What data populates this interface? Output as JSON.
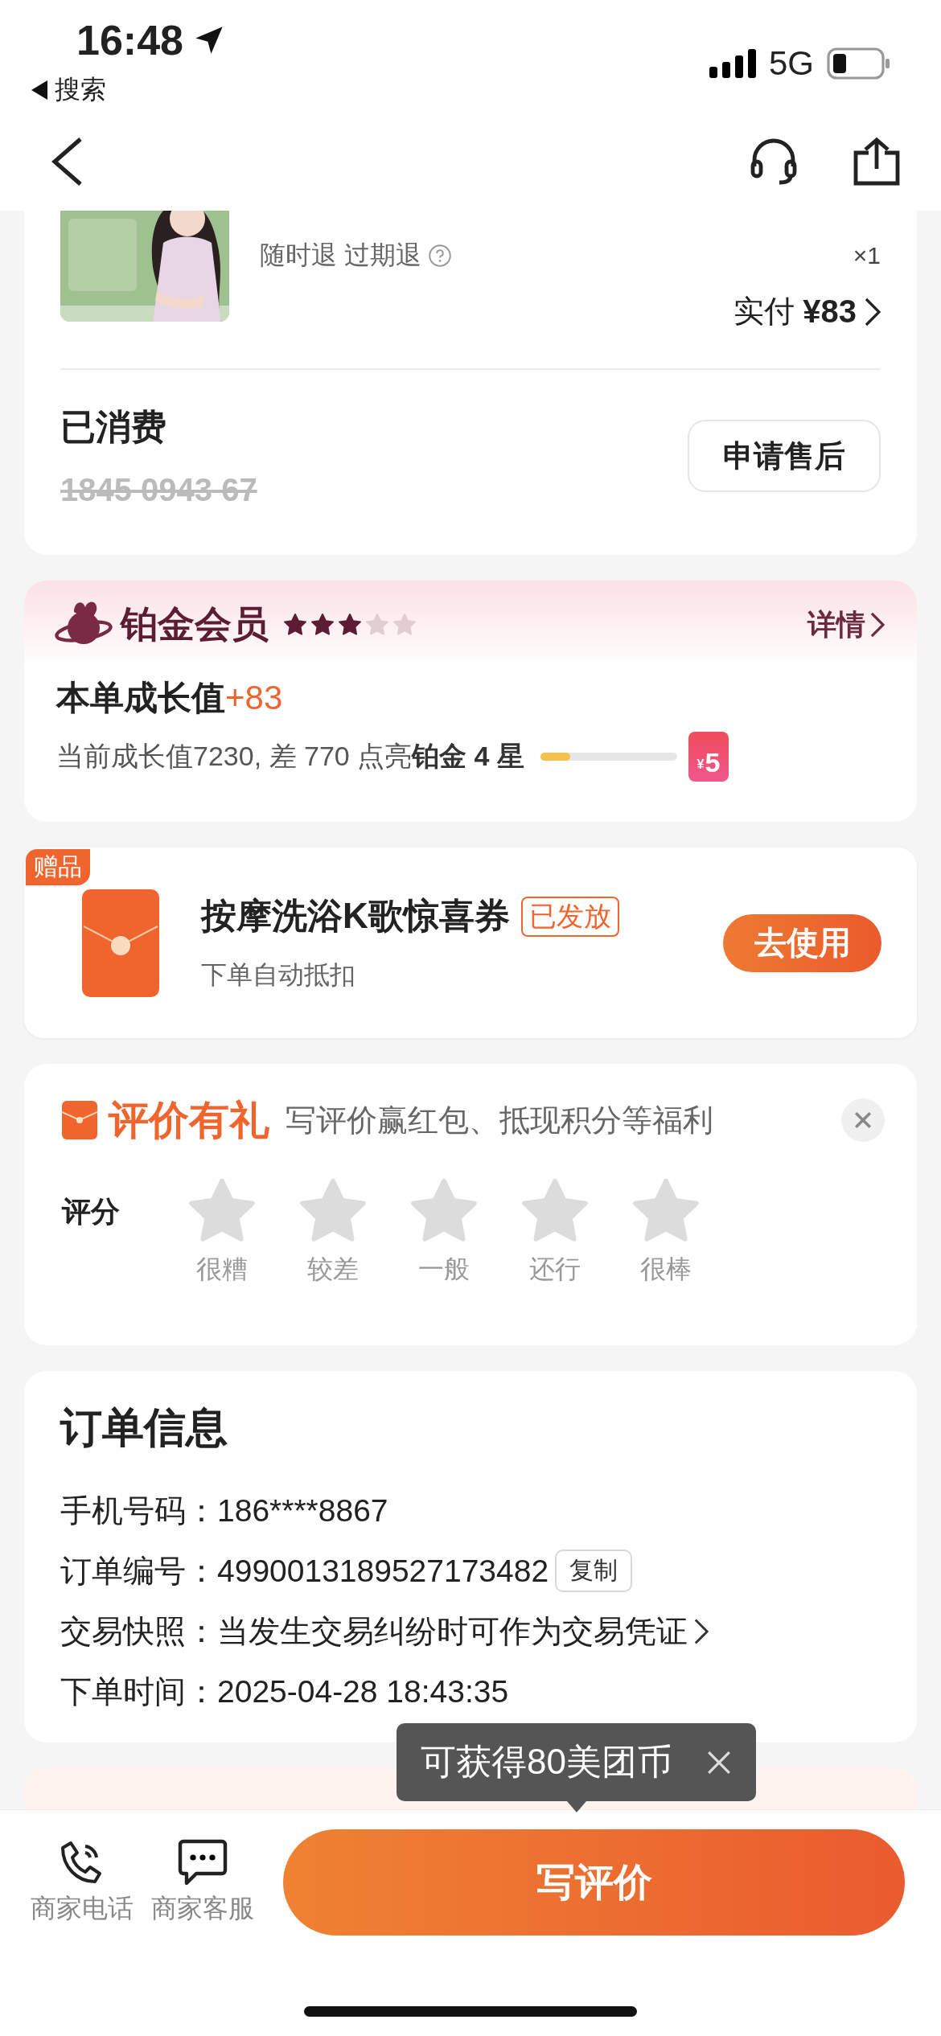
{
  "status_bar": {
    "time": "16:48",
    "back_app": "搜索",
    "network": "5G"
  },
  "product": {
    "tags": "随时退 过期退",
    "quantity": "×1",
    "paid_label": "实付",
    "paid_amount": "¥83",
    "status": "已消费",
    "code": "1845 0943 67",
    "code_used": true,
    "after_sale_button": "申请售后"
  },
  "member": {
    "title": "铂金会员",
    "stars": 3,
    "detail_link": "详情",
    "growth_label": "本单成长值",
    "growth_value": "+83",
    "progress_text": "当前成长值7230, 差 770 点亮**铂金 4 星**",
    "level": 0.22,
    "reward_currency": "¥",
    "reward_amount": "5"
  },
  "gift": {
    "tag": "赠品",
    "title": "按摩洗浴K歌惊喜券",
    "status": "已发放",
    "note": "下单自动抵扣",
    "button": "去使用"
  },
  "review": {
    "title": "评价有礼",
    "subtitle": "写评价赢红包、抵现积分等福利",
    "rating_label": "评分",
    "stars": 0,
    "star_labels": [
      "很糟",
      "较差",
      "一般",
      "还行",
      "很棒"
    ]
  },
  "order_info": {
    "title": "订单信息",
    "rows": [
      {
        "kind": "plain",
        "text": "手机号码：186****8867"
      },
      {
        "kind": "copy",
        "text": "订单编号：4990013189527173482",
        "action": "复制"
      },
      {
        "kind": "link",
        "text": "交易快照：当发生交易纠纷时可作为交易凭证"
      },
      {
        "kind": "plain",
        "text": "下单时间：2025-04-28 18:43:35"
      }
    ]
  },
  "tooltip": {
    "text": "可获得80美团币"
  },
  "bottom_bar": {
    "actions": [
      {
        "kind": "phone",
        "label": "商家电话"
      },
      {
        "kind": "chat",
        "label": "商家客服"
      }
    ],
    "primary_button": "写评价"
  }
}
